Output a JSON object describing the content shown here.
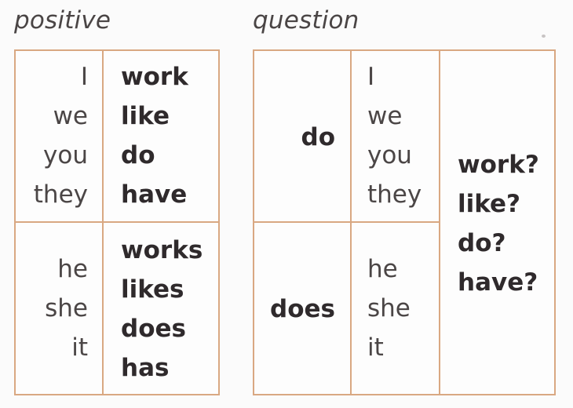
{
  "positive": {
    "title": "positive",
    "top": {
      "pronouns": [
        "I",
        "we",
        "you",
        "they"
      ],
      "verbs": [
        "work",
        "like",
        "do",
        "have"
      ]
    },
    "bottom": {
      "pronouns": [
        "he",
        "she",
        "it"
      ],
      "verbs": [
        "works",
        "likes",
        "does",
        "has"
      ]
    }
  },
  "question": {
    "title": "question",
    "top": {
      "aux": "do",
      "pronouns": [
        "I",
        "we",
        "you",
        "they"
      ]
    },
    "bottom": {
      "aux": "does",
      "pronouns": [
        "he",
        "she",
        "it"
      ]
    },
    "verbs": [
      "work?",
      "like?",
      "do?",
      "have?"
    ]
  }
}
